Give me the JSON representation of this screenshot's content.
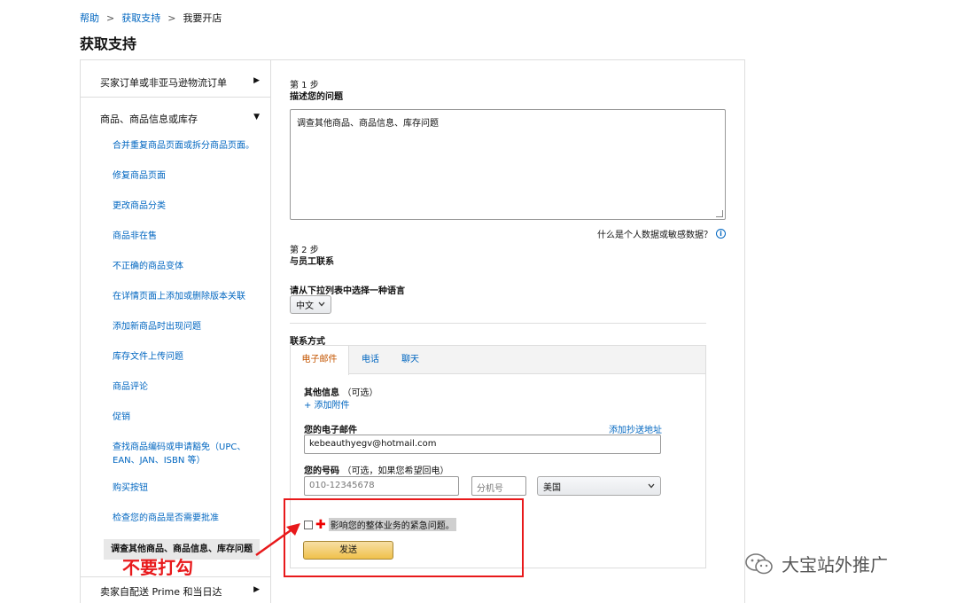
{
  "breadcrumb": {
    "items": [
      "帮助",
      "获取支持",
      "我要开店"
    ],
    "sep": ">"
  },
  "page_title": "获取支持",
  "sidebar": {
    "cat1": {
      "label": "买家订单或非亚马逊物流订单",
      "arrow": "▶"
    },
    "cat2": {
      "label": "商品、商品信息或库存",
      "arrow": "▼"
    },
    "items": [
      "合并重复商品页面或拆分商品页面。",
      "修复商品页面",
      "更改商品分类",
      "商品非在售",
      "不正确的商品变体",
      "在详情页面上添加或删除版本关联",
      "添加新商品时出现问题",
      "库存文件上传问题",
      "商品评论",
      "促销",
      "查找商品编码或申请豁免（UPC、EAN、JAN、ISBN 等）",
      "购买按钮",
      "检查您的商品是否需要批准",
      "调查其他商品、商品信息、库存问题"
    ],
    "cat3": {
      "label": "卖家自配送 Prime 和当日达",
      "arrow": "▶"
    }
  },
  "step1": {
    "label": "第 1 步",
    "title": "描述您的问题",
    "textarea_value": "调查其他商品、商品信息、库存问题"
  },
  "privacy_link": "什么是个人数据或敏感数据？",
  "step2": {
    "label": "第 2 步",
    "title": "与员工联系"
  },
  "language": {
    "label": "请从下拉列表中选择一种语言",
    "selected": "中文"
  },
  "contact": {
    "label": "联系方式",
    "tabs": [
      "电子邮件",
      "电话",
      "聊天"
    ],
    "other_info_label": "其他信息",
    "optional": "（可选）",
    "add_attachment": "+ 添加附件",
    "email_label": "您的电子邮件",
    "add_cc": "添加抄送地址",
    "email_value": "kebeauthyegv@hotmail.com",
    "phone_label": "您的号码",
    "phone_optional": "（可选，如果您希望回电）",
    "phone_placeholder": "010-12345678",
    "ext_placeholder": "分机号",
    "country": "美国",
    "urgent_text": "影响您的整体业务的紧急问题。",
    "send_button": "发送"
  },
  "annotation": {
    "text": "不要打勾"
  },
  "watermark": "大宝站外推广",
  "colors": {
    "link": "#0066c0",
    "active_tab": "#c45500",
    "button": "#f0c14b",
    "annotation": "#e8191b"
  }
}
